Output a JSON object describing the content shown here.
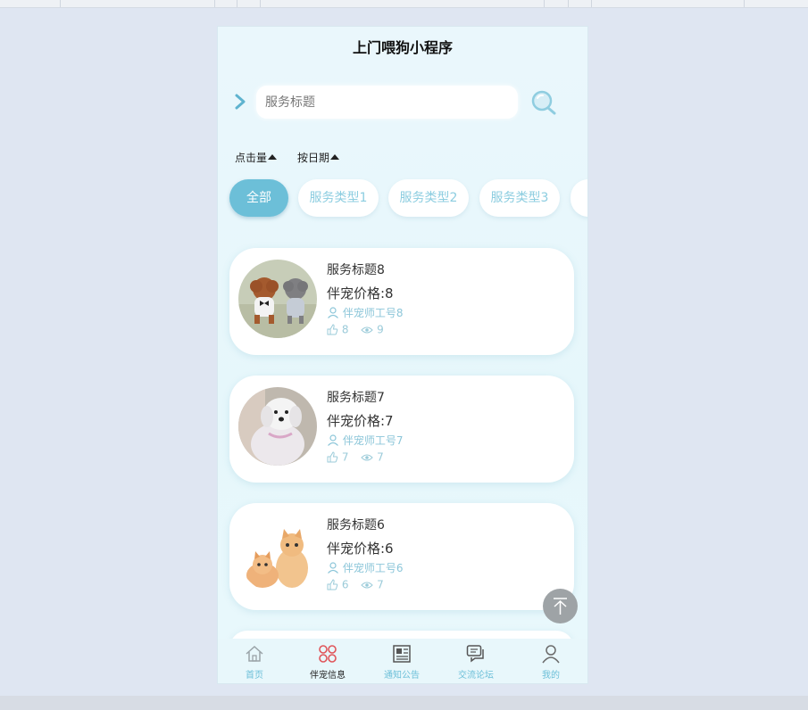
{
  "app": {
    "title": "上门喂狗小程序"
  },
  "search": {
    "placeholder": "服务标题"
  },
  "sort": {
    "clicks_label": "点击量",
    "date_label": "按日期"
  },
  "categories": [
    "全部",
    "服务类型1",
    "服务类型2",
    "服务类型3"
  ],
  "items": [
    {
      "title": "服务标题8",
      "price": "伴宠价格:8",
      "staff": "伴宠师工号8",
      "likes": "8",
      "views": "9"
    },
    {
      "title": "服务标题7",
      "price": "伴宠价格:7",
      "staff": "伴宠师工号7",
      "likes": "7",
      "views": "7"
    },
    {
      "title": "服务标题6",
      "price": "伴宠价格:6",
      "staff": "伴宠师工号6",
      "likes": "6",
      "views": "7"
    }
  ],
  "tabbar": [
    {
      "label": "首页",
      "icon": "home-icon"
    },
    {
      "label": "伴宠信息",
      "icon": "pet-info-icon"
    },
    {
      "label": "通知公告",
      "icon": "notice-icon"
    },
    {
      "label": "交流论坛",
      "icon": "forum-icon"
    },
    {
      "label": "我的",
      "icon": "user-icon"
    }
  ],
  "colors": {
    "accent": "#6cbfd8",
    "page_bg": "#dfe6f2"
  }
}
